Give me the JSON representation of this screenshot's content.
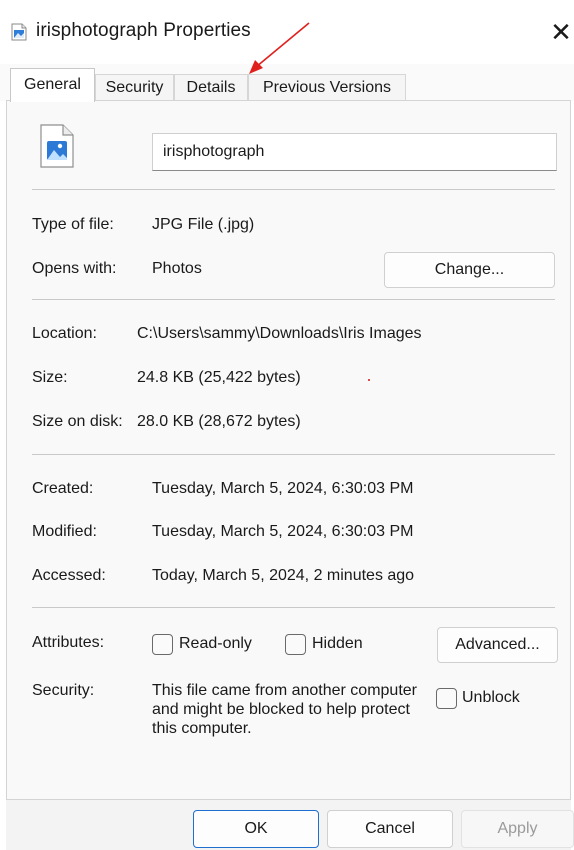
{
  "window": {
    "title": "irisphotograph Properties",
    "close_glyph": "✕",
    "app_icon": "image-file-icon"
  },
  "tabs": [
    {
      "label": "General",
      "active": true
    },
    {
      "label": "Security",
      "active": false
    },
    {
      "label": "Details",
      "active": false
    },
    {
      "label": "Previous Versions",
      "active": false
    }
  ],
  "file": {
    "icon": "image-file-icon",
    "name": "irisphotograph"
  },
  "type_section": {
    "type_label": "Type of file:",
    "type_value": "JPG File (.jpg)",
    "opens_label": "Opens with:",
    "opens_value": "Photos",
    "change_button": "Change..."
  },
  "location_section": {
    "location_label": "Location:",
    "location_value": "C:\\Users\\sammy\\Downloads\\Iris Images",
    "size_label": "Size:",
    "size_value": "24.8 KB (25,422 bytes)",
    "size_disk_label": "Size on disk:",
    "size_disk_value": "28.0 KB (28,672 bytes)"
  },
  "dates_section": {
    "created_label": "Created:",
    "created_value": "Tuesday, March 5, 2024, 6:30:03 PM",
    "modified_label": "Modified:",
    "modified_value": "Tuesday, March 5, 2024, 6:30:03 PM",
    "accessed_label": "Accessed:",
    "accessed_value": "Today, March 5, 2024, 2 minutes ago"
  },
  "attributes_section": {
    "attributes_label": "Attributes:",
    "readonly_label": "Read-only",
    "readonly_checked": false,
    "hidden_label": "Hidden",
    "hidden_checked": false,
    "advanced_button": "Advanced...",
    "security_label": "Security:",
    "security_text": "This file came from another computer and might be blocked to help protect this computer.",
    "unblock_label": "Unblock",
    "unblock_checked": false
  },
  "footer": {
    "ok": "OK",
    "cancel": "Cancel",
    "apply": "Apply"
  },
  "colors": {
    "annotation_arrow": "#e0201c",
    "primary_border": "#1f6fd1"
  }
}
